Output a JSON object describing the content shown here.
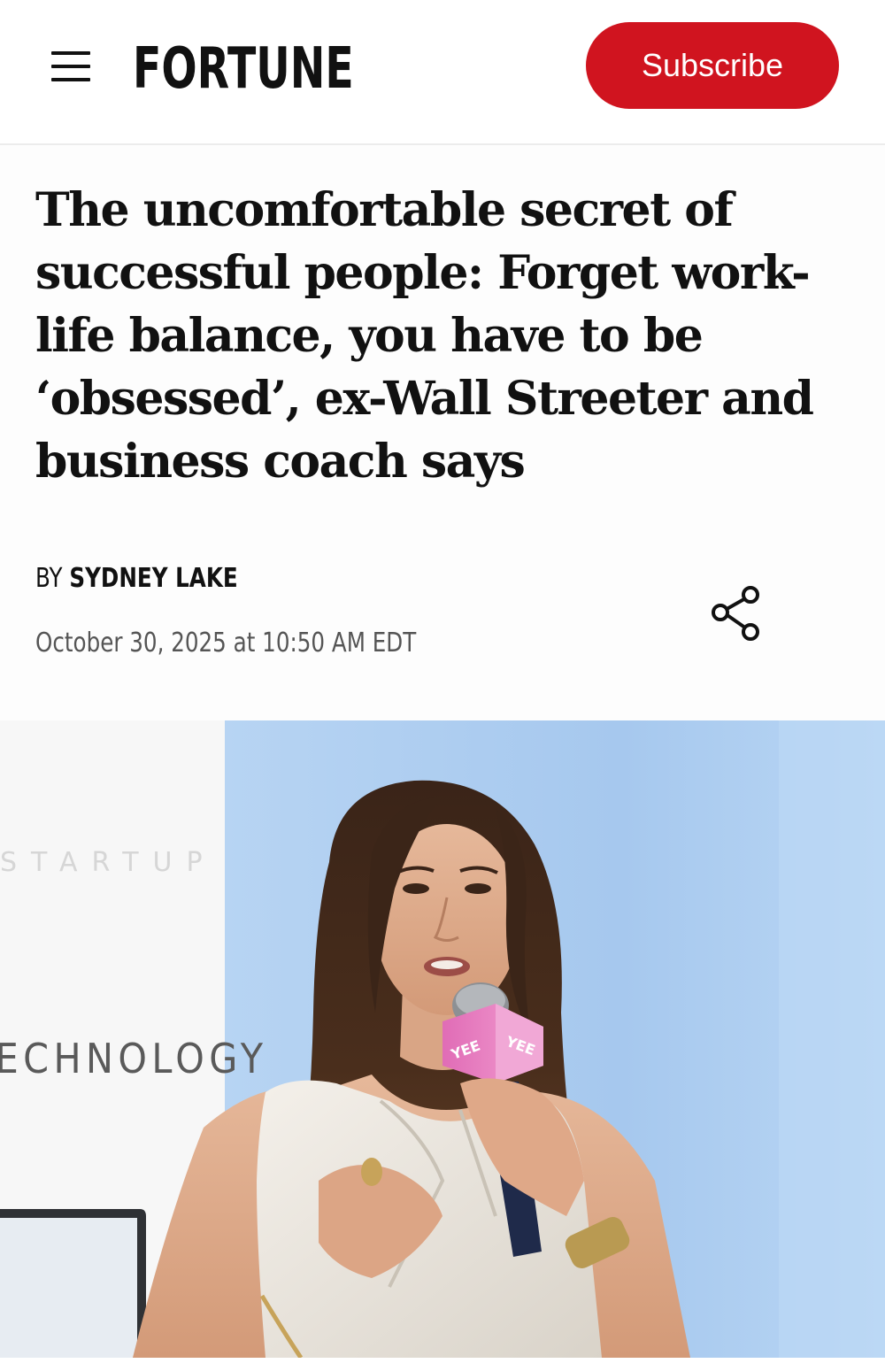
{
  "header": {
    "logo_text": "FORTUNE",
    "menu_icon": "hamburger-menu-icon",
    "subscribe_label": "Subscribe"
  },
  "article": {
    "headline": "The uncomfortable secret of successful people: Forget work-life balance, you have to be ‘obsessed’, ex-Wall Streeter and business coach says",
    "byline_prefix": "BY",
    "author": "SYDNEY LAKE",
    "timestamp": "October 30, 2025 at 10:50 AM EDT",
    "share_icon": "share-icon"
  },
  "hero_image": {
    "backdrop_text": "ECHNOLOGY",
    "mic_flag_text": "YEE"
  },
  "colors": {
    "brand_red": "#d0141f",
    "text": "#111111",
    "muted_text": "#555555",
    "hero_backdrop_blue": "#a9cbef"
  }
}
